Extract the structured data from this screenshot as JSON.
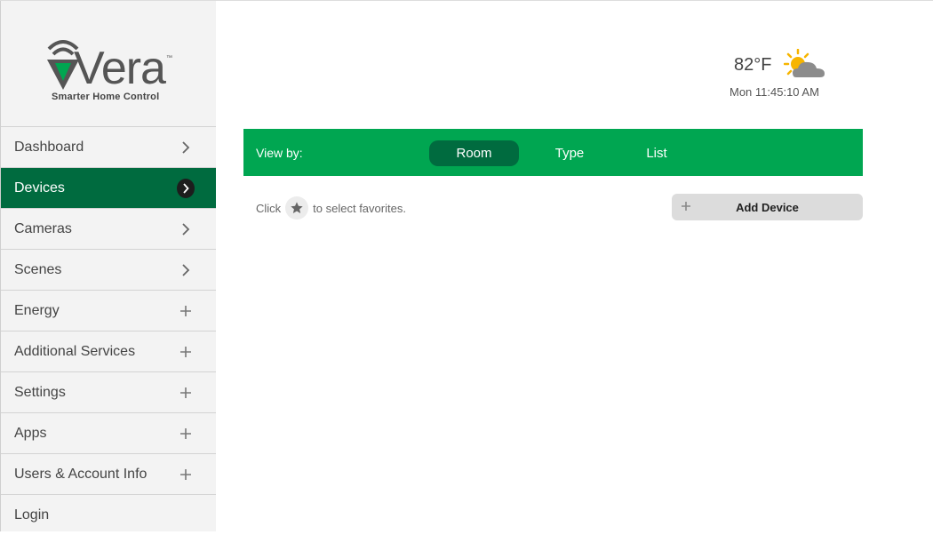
{
  "brand": {
    "name": "Vera",
    "tm": "™",
    "tagline": "Smarter Home Control",
    "accent": "#00a651",
    "accent_dark": "#006b3f"
  },
  "sidebar": {
    "items": [
      {
        "label": "Dashboard",
        "icon": "chevron-right-icon"
      },
      {
        "label": "Devices",
        "icon": "chevron-right-circle-icon",
        "active": true
      },
      {
        "label": "Cameras",
        "icon": "chevron-right-icon"
      },
      {
        "label": "Scenes",
        "icon": "chevron-right-icon"
      },
      {
        "label": "Energy",
        "icon": "plus-icon"
      },
      {
        "label": "Additional Services",
        "icon": "plus-icon"
      },
      {
        "label": "Settings",
        "icon": "plus-icon"
      },
      {
        "label": "Apps",
        "icon": "plus-icon"
      },
      {
        "label": "Users & Account Info",
        "icon": "plus-icon"
      },
      {
        "label": "Login",
        "icon": ""
      }
    ]
  },
  "header": {
    "temperature": "82°F",
    "weather_icon": "partly-cloudy-icon",
    "datetime": "Mon 11:45:10 AM"
  },
  "view_bar": {
    "label": "View by:",
    "tabs": [
      {
        "label": "Room",
        "active": true
      },
      {
        "label": "Type"
      },
      {
        "label": "List"
      }
    ]
  },
  "favorites": {
    "prefix": "Click",
    "suffix": "to select favorites."
  },
  "add_device": {
    "label": "Add Device"
  }
}
